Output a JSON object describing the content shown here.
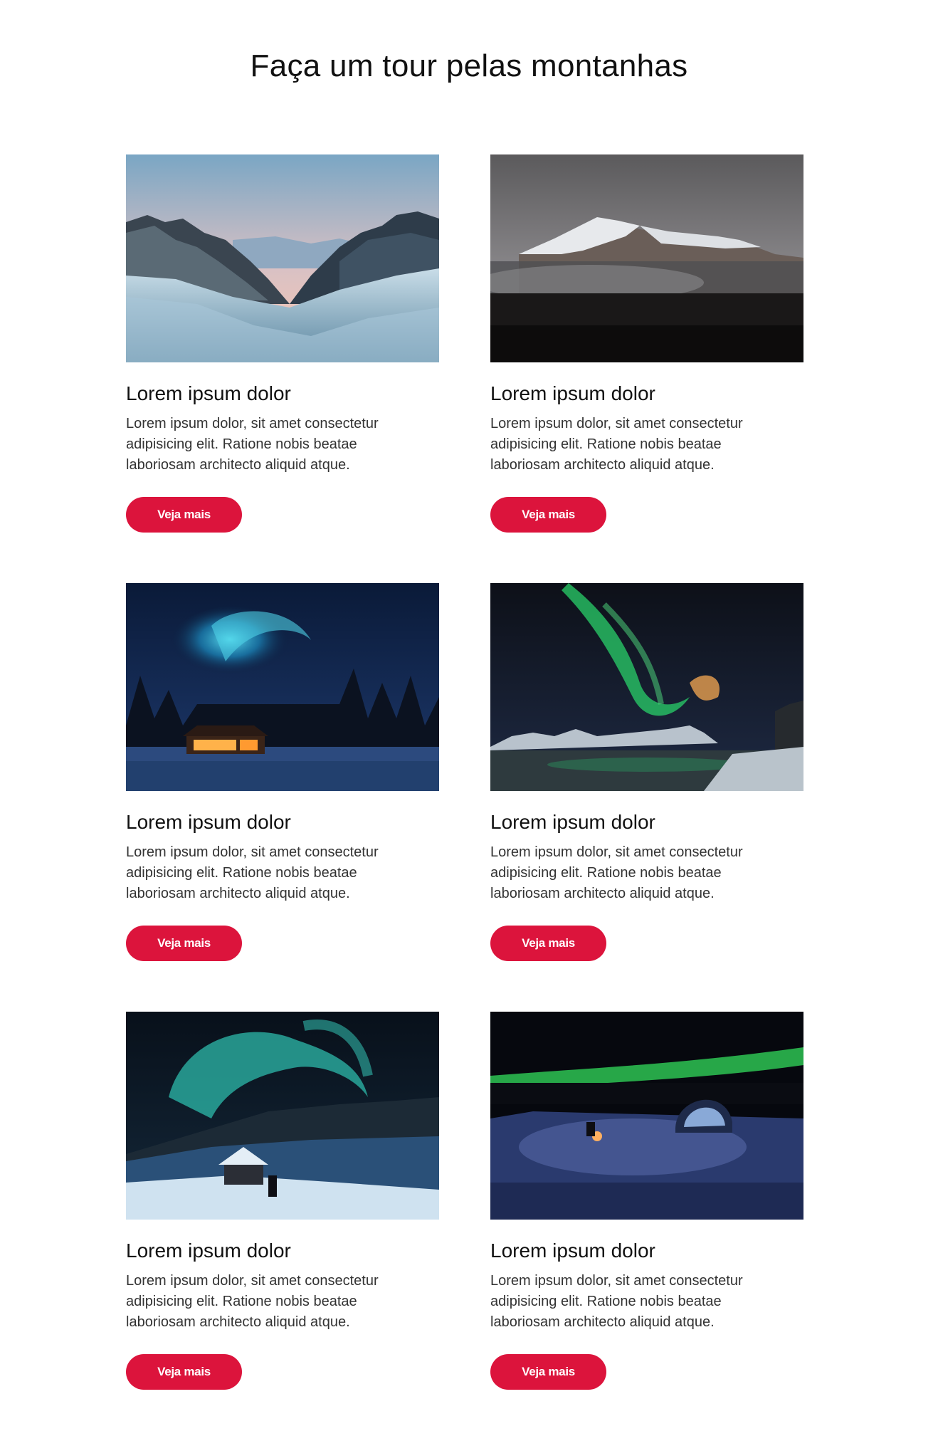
{
  "page_title": "Faça um tour pelas montanhas",
  "accent_color": "#dc143c",
  "cards": [
    {
      "image": "snowy-mountain-valley-photo",
      "title": "Lorem ipsum dolor",
      "text": "Lorem ipsum dolor, sit amet consectetur adipisicing elit. Ratione nobis beatae laboriosam architecto aliquid atque.",
      "button_label": "Veja mais"
    },
    {
      "image": "snow-capped-peak-in-mist-photo",
      "title": "Lorem ipsum dolor",
      "text": "Lorem ipsum dolor, sit amet consectetur adipisicing elit. Ratione nobis beatae laboriosam architecto aliquid atque.",
      "button_label": "Veja mais"
    },
    {
      "image": "aurora-over-lit-cabin-photo",
      "title": "Lorem ipsum dolor",
      "text": "Lorem ipsum dolor, sit amet consectetur adipisicing elit. Ratione nobis beatae laboriosam architecto aliquid atque.",
      "button_label": "Veja mais"
    },
    {
      "image": "green-aurora-over-fjord-photo",
      "title": "Lorem ipsum dolor",
      "text": "Lorem ipsum dolor, sit amet consectetur adipisicing elit. Ratione nobis beatae laboriosam architecto aliquid atque.",
      "button_label": "Veja mais"
    },
    {
      "image": "aurora-person-snowy-hill-photo",
      "title": "Lorem ipsum dolor",
      "text": "Lorem ipsum dolor, sit amet consectetur adipisicing elit. Ratione nobis beatae laboriosam architecto aliquid atque.",
      "button_label": "Veja mais"
    },
    {
      "image": "glass-igloo-under-aurora-photo",
      "title": "Lorem ipsum dolor",
      "text": "Lorem ipsum dolor, sit amet consectetur adipisicing elit. Ratione nobis beatae laboriosam architecto aliquid atque.",
      "button_label": "Veja mais"
    }
  ]
}
